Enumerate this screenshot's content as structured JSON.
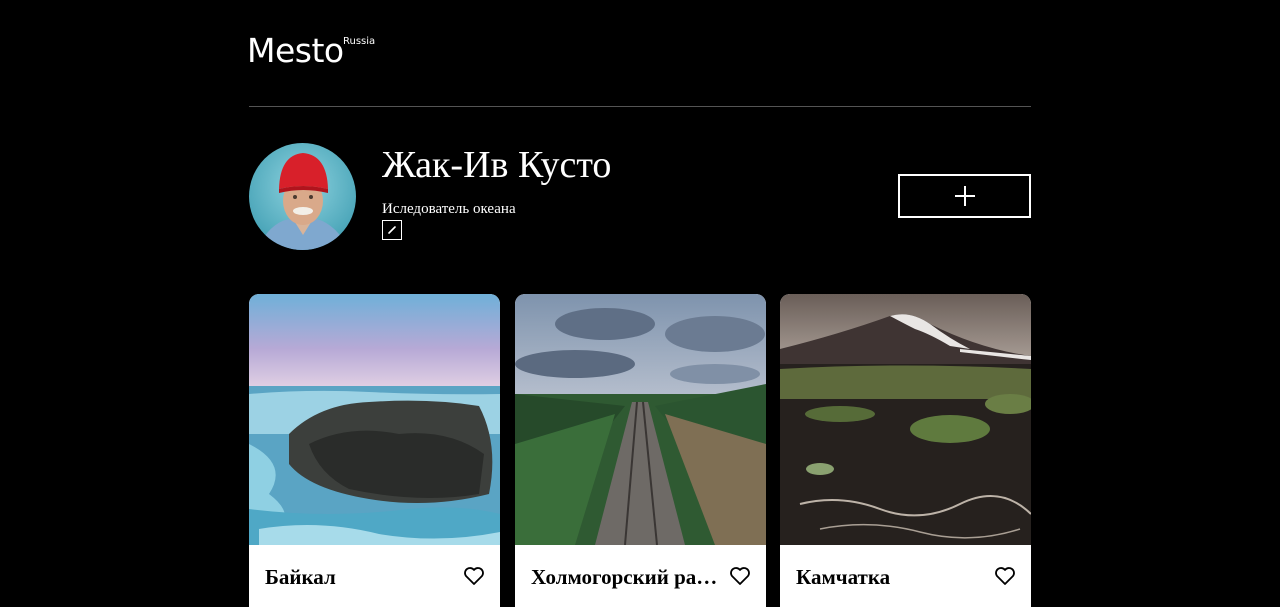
{
  "header": {
    "logo_text": "Mesto",
    "logo_sup": "Russia"
  },
  "profile": {
    "name": "Жак-Ив Кусто",
    "about": "Иследователь океана",
    "avatar_icon": "avatar-photo",
    "edit_icon": "pencil-icon",
    "add_icon": "plus-icon"
  },
  "cards": [
    {
      "title": "Байкал",
      "like_icon": "heart-icon"
    },
    {
      "title": "Холмогорский район",
      "like_icon": "heart-icon"
    },
    {
      "title": "Камчатка",
      "like_icon": "heart-icon"
    }
  ],
  "colors": {
    "background": "#000000",
    "text": "#ffffff",
    "card_background": "#ffffff",
    "divider": "#545454"
  }
}
